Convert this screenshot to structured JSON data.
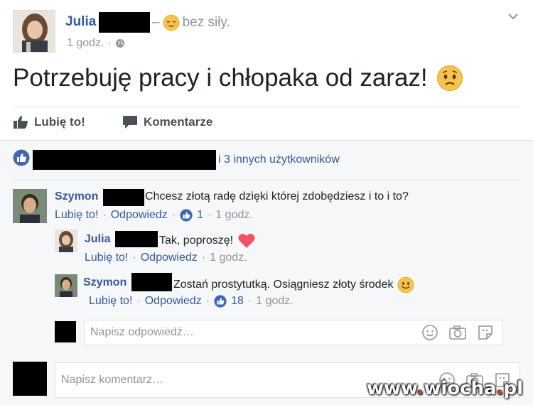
{
  "post": {
    "author": "Julia",
    "feeling_prefix": "–",
    "feeling_text": "bez siły.",
    "time": "1 godz.",
    "text": "Potrzebuję pracy i chłopaka od zaraz!"
  },
  "actions": {
    "like_label": "Lubię to!",
    "comment_label": "Komentarze"
  },
  "likes": {
    "others_text": "i 3 innych użytkowników"
  },
  "comments": [
    {
      "author": "Szymon",
      "text": "Chcesz złotą radę dzięki której zdobędziesz i to i to?",
      "like_label": "Lubię to!",
      "reply_label": "Odpowiedz",
      "likes": "1",
      "time": "1 godz."
    }
  ],
  "replies": [
    {
      "author": "Julia",
      "text": "Tak, poproszę!",
      "like_label": "Lubię to!",
      "reply_label": "Odpowiedz",
      "time": "1 godz."
    },
    {
      "author": "Szymon",
      "text": "Zostań prostytutką. Osiągniesz złoty środek",
      "like_label": "Lubię to!",
      "reply_label": "Odpowiedz",
      "likes": "18",
      "time": "1 godz."
    }
  ],
  "reply_input": {
    "placeholder": "Napisz odpowiedź…"
  },
  "comment_input": {
    "placeholder": "Napisz komentarz…"
  },
  "watermark": {
    "main": "www",
    "dot1": ".",
    "brand": "wiocha",
    "dot2": ".",
    "tld": "pl"
  },
  "colors": {
    "link": "#365899",
    "meta": "#90949c",
    "like_blue": "#4267b2",
    "heart": "#f25268",
    "emoji": "#f7c34a"
  }
}
